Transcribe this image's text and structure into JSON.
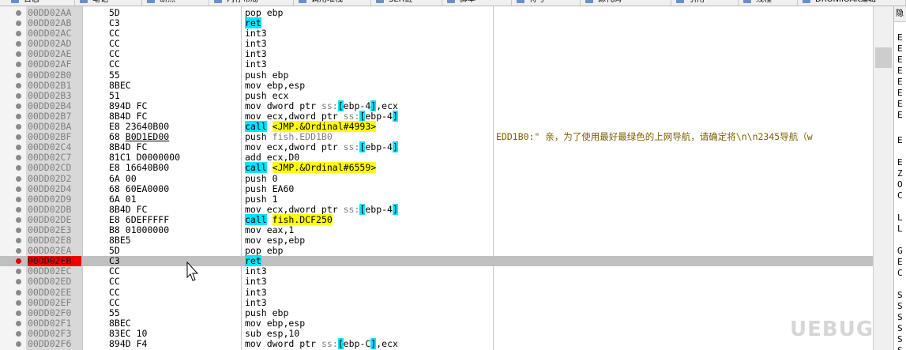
{
  "tabs": [
    "日志",
    "笔记",
    "断点",
    "内存布局",
    "调用堆栈",
    "SEH链",
    "脚本",
    "符号",
    "源代码",
    "引用",
    "线程",
    "DRONIIOAK编辑"
  ],
  "disasm_rows": [
    {
      "addr": "00DD02AA",
      "hex": "5D",
      "ins": [
        [
          "pop ebp",
          ""
        ]
      ]
    },
    {
      "addr": "00DD02AB",
      "hex": "C3",
      "ins": [
        [
          "ret",
          "cy"
        ]
      ]
    },
    {
      "addr": "00DD02AC",
      "hex": "CC",
      "ins": [
        [
          "int3",
          ""
        ]
      ]
    },
    {
      "addr": "00DD02AD",
      "hex": "CC",
      "ins": [
        [
          "int3",
          ""
        ]
      ]
    },
    {
      "addr": "00DD02AE",
      "hex": "CC",
      "ins": [
        [
          "int3",
          ""
        ]
      ]
    },
    {
      "addr": "00DD02AF",
      "hex": "CC",
      "ins": [
        [
          "int3",
          ""
        ]
      ]
    },
    {
      "addr": "00DD02B0",
      "hex": "55",
      "ins": [
        [
          "push ebp",
          ""
        ]
      ]
    },
    {
      "addr": "00DD02B1",
      "hex": "8BEC",
      "ins": [
        [
          "mov ebp,esp",
          ""
        ]
      ]
    },
    {
      "addr": "00DD02B3",
      "hex": "51",
      "ins": [
        [
          "push ecx",
          ""
        ]
      ]
    },
    {
      "addr": "00DD02B4",
      "hex": "894D FC",
      "ins": [
        [
          "mov dword ptr ",
          ""
        ],
        [
          "ss:",
          "gr"
        ],
        [
          "[",
          "cy"
        ],
        [
          "ebp-4",
          ""
        ],
        [
          "]",
          "cy"
        ],
        [
          ",ecx",
          ""
        ]
      ]
    },
    {
      "addr": "00DD02B7",
      "hex": "8B4D FC",
      "ins": [
        [
          "mov ecx,dword ptr ",
          ""
        ],
        [
          "ss:",
          "gr"
        ],
        [
          "[",
          "cy"
        ],
        [
          "ebp-4",
          ""
        ],
        [
          "]",
          "cy"
        ]
      ]
    },
    {
      "addr": "00DD02BA",
      "hex": "E8 23640B00",
      "ins": [
        [
          "call",
          "cy"
        ],
        [
          " ",
          ""
        ],
        [
          "<JMP.&Ordinal#4993>",
          "yl"
        ]
      ]
    },
    {
      "addr": "00DD02BF",
      "hex": "68 B0D1ED00",
      "hexu": true,
      "ins": [
        [
          "push ",
          ""
        ],
        [
          "fish.EDD1B0",
          "gr"
        ]
      ],
      "cmt": "EDD1B0:\"    亲，为了使用最好最绿色的上网导航，请确定将\\n\\n2345导航（w"
    },
    {
      "addr": "00DD02C4",
      "hex": "8B4D FC",
      "ins": [
        [
          "mov ecx,dword ptr ",
          ""
        ],
        [
          "ss:",
          "gr"
        ],
        [
          "[",
          "cy"
        ],
        [
          "ebp-4",
          ""
        ],
        [
          "]",
          "cy"
        ]
      ]
    },
    {
      "addr": "00DD02C7",
      "hex": "81C1 D0000000",
      "ins": [
        [
          "add ecx,D0",
          ""
        ]
      ]
    },
    {
      "addr": "00DD02CD",
      "hex": "E8 16640B00",
      "ins": [
        [
          "call",
          "cy"
        ],
        [
          " ",
          ""
        ],
        [
          "<JMP.&Ordinal#6559>",
          "yl"
        ]
      ]
    },
    {
      "addr": "00DD02D2",
      "hex": "6A 00",
      "ins": [
        [
          "push 0",
          ""
        ]
      ]
    },
    {
      "addr": "00DD02D4",
      "hex": "68 60EA0000",
      "ins": [
        [
          "push EA60",
          ""
        ]
      ]
    },
    {
      "addr": "00DD02D9",
      "hex": "6A 01",
      "ins": [
        [
          "push 1",
          ""
        ]
      ]
    },
    {
      "addr": "00DD02DB",
      "hex": "8B4D FC",
      "ins": [
        [
          "mov ecx,dword ptr ",
          ""
        ],
        [
          "ss:",
          "gr"
        ],
        [
          "[",
          "cy"
        ],
        [
          "ebp-4",
          ""
        ],
        [
          "]",
          "cy"
        ]
      ]
    },
    {
      "addr": "00DD02DE",
      "hex": "E8 6DEFFFFF",
      "ins": [
        [
          "call",
          "cy"
        ],
        [
          " ",
          ""
        ],
        [
          "fish.DCF250",
          "yl"
        ]
      ]
    },
    {
      "addr": "00DD02E3",
      "hex": "B8 01000000",
      "ins": [
        [
          "mov eax,1",
          ""
        ]
      ]
    },
    {
      "addr": "00DD02E8",
      "hex": "8BE5",
      "ins": [
        [
          "mov esp,ebp",
          ""
        ]
      ]
    },
    {
      "addr": "00DD02EA",
      "hex": "5D",
      "ins": [
        [
          "pop ebp",
          ""
        ]
      ]
    },
    {
      "addr": "00DD02EB",
      "hex": "C3",
      "ins": [
        [
          "ret",
          "cy"
        ]
      ],
      "bp": true,
      "sel": true
    },
    {
      "addr": "00DD02EC",
      "hex": "CC",
      "ins": [
        [
          "int3",
          ""
        ]
      ]
    },
    {
      "addr": "00DD02ED",
      "hex": "CC",
      "ins": [
        [
          "int3",
          ""
        ]
      ]
    },
    {
      "addr": "00DD02EE",
      "hex": "CC",
      "ins": [
        [
          "int3",
          ""
        ]
      ]
    },
    {
      "addr": "00DD02EF",
      "hex": "CC",
      "ins": [
        [
          "int3",
          ""
        ]
      ]
    },
    {
      "addr": "00DD02F0",
      "hex": "55",
      "ins": [
        [
          "push ebp",
          ""
        ]
      ]
    },
    {
      "addr": "00DD02F1",
      "hex": "8BEC",
      "ins": [
        [
          "mov ebp,esp",
          ""
        ]
      ]
    },
    {
      "addr": "00DD02F3",
      "hex": "83EC 10",
      "ins": [
        [
          "sub esp,10",
          ""
        ]
      ]
    },
    {
      "addr": "00DD02F6",
      "hex": "894D F4",
      "ins": [
        [
          "mov dword ptr ",
          ""
        ],
        [
          "ss:",
          "gr"
        ],
        [
          "[",
          "cy"
        ],
        [
          "ebp-C",
          ""
        ],
        [
          "]",
          "cy"
        ],
        [
          ",ecx",
          ""
        ]
      ]
    }
  ],
  "reg_panel": {
    "header": "隐",
    "labels": [
      "E",
      "E",
      "E",
      "E",
      "E",
      "E",
      "E",
      "E",
      "E",
      "E",
      "Z",
      "O",
      "C",
      "L",
      "L",
      "G",
      "E",
      "C",
      "S",
      "S",
      "S",
      "S",
      "S",
      "S"
    ]
  },
  "watermark": "UEBUG"
}
